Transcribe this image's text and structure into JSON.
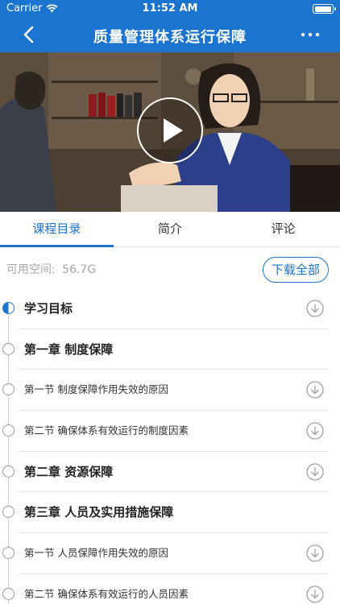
{
  "status_bar": {
    "carrier": "Carrier",
    "time": "11:52 AM",
    "battery_level": 1.0
  },
  "nav": {
    "title": "质量管理体系运行保障",
    "back_icon": "chevron-left-icon",
    "more_icon": "more-horizontal-icon"
  },
  "video": {
    "play_icon": "play-icon"
  },
  "tabs": [
    {
      "label": "课程目录",
      "active": true
    },
    {
      "label": "简介",
      "active": false
    },
    {
      "label": "评论",
      "active": false
    }
  ],
  "storage": {
    "label": "可用空间:",
    "value": "56.7G",
    "download_all_label": "下载全部"
  },
  "catalog": [
    {
      "label": "学习目标",
      "kind": "chapter",
      "current": true,
      "downloadable": true
    },
    {
      "label": "第一章 制度保障",
      "kind": "chapter",
      "current": false,
      "downloadable": false
    },
    {
      "label": "第一节 制度保障作用失效的原因",
      "kind": "section",
      "current": false,
      "downloadable": true
    },
    {
      "label": "第二节 确保体系有效运行的制度因素",
      "kind": "section",
      "current": false,
      "downloadable": true
    },
    {
      "label": "第二章 资源保障",
      "kind": "chapter",
      "current": false,
      "downloadable": true
    },
    {
      "label": "第三章 人员及实用措施保障",
      "kind": "chapter",
      "current": false,
      "downloadable": false
    },
    {
      "label": "第一节 人员保障作用失效的原因",
      "kind": "section",
      "current": false,
      "downloadable": true
    },
    {
      "label": "第二节 确保体系有效运行的人员因素",
      "kind": "section",
      "current": false,
      "downloadable": true
    }
  ],
  "colors": {
    "primary": "#1b74d0",
    "muted_text": "#a8a8a8",
    "divider": "#e8e8e8"
  }
}
